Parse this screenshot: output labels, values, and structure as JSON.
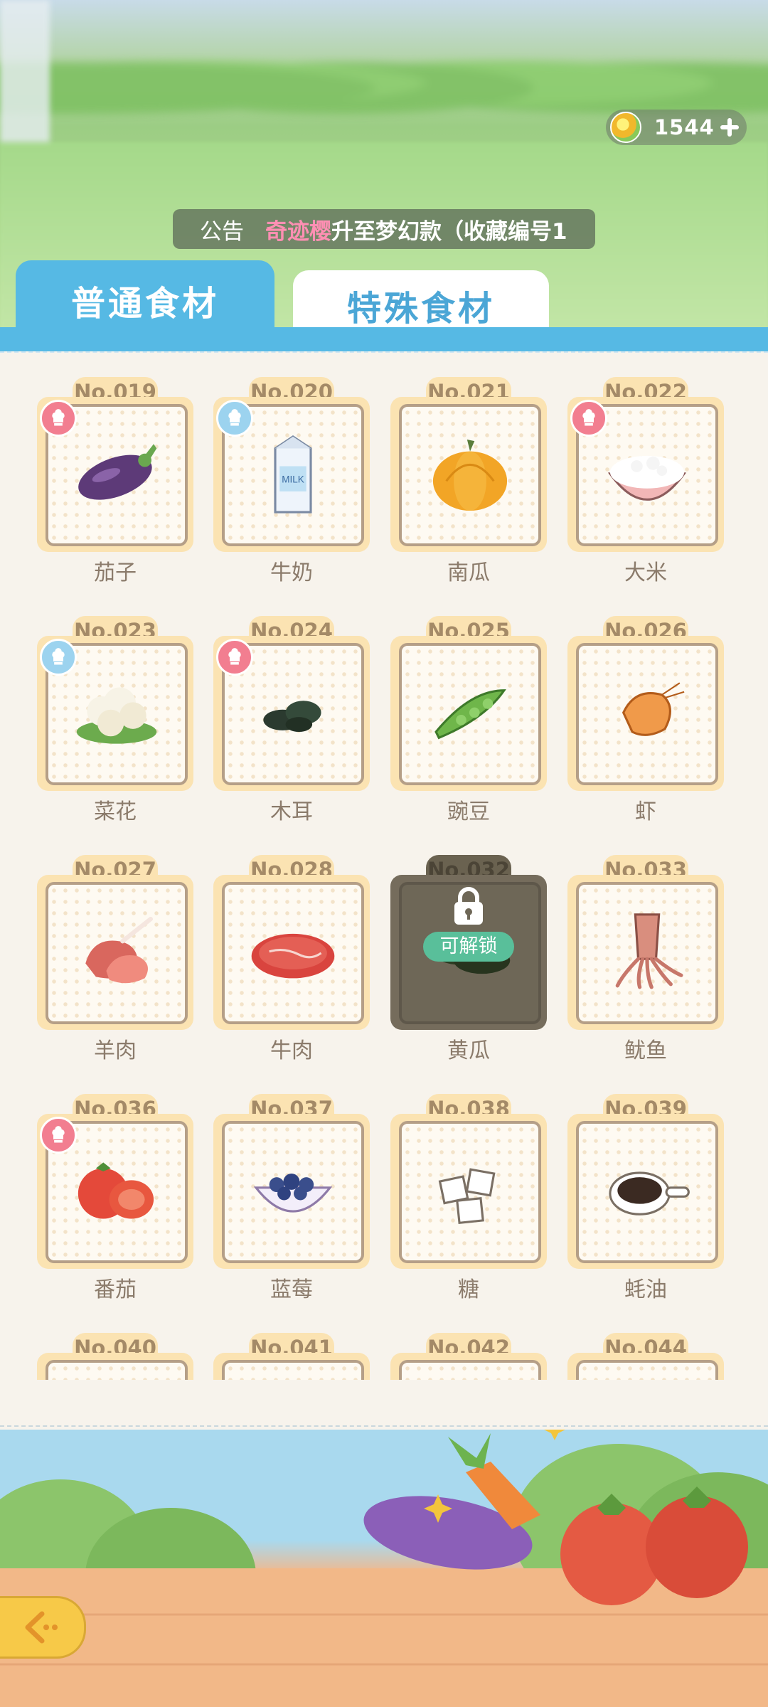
{
  "header": {
    "currency": {
      "value": "1544",
      "icon": "gem-coin-icon",
      "add_icon": "plus-icon"
    },
    "notice": {
      "label": "公告",
      "highlight": "奇迹樱",
      "text": "升至梦幻款（收藏编号1"
    }
  },
  "tabs": [
    {
      "label": "普通食材",
      "active": true
    },
    {
      "label": "特殊食材",
      "active": false
    }
  ],
  "colors": {
    "accent": "#56b9e4",
    "frame": "#fbe3b2",
    "label": "#8b7b6b",
    "unlock": "#59bf9a"
  },
  "items": [
    {
      "no": "No.019",
      "name": "茄子",
      "icon": "eggplant-icon",
      "badge": "pink"
    },
    {
      "no": "No.020",
      "name": "牛奶",
      "icon": "milk-carton-icon",
      "badge": "blue"
    },
    {
      "no": "No.021",
      "name": "南瓜",
      "icon": "pumpkin-icon",
      "badge": ""
    },
    {
      "no": "No.022",
      "name": "大米",
      "icon": "rice-bowl-icon",
      "badge": "pink"
    },
    {
      "no": "No.023",
      "name": "菜花",
      "icon": "cauliflower-icon",
      "badge": "blue"
    },
    {
      "no": "No.024",
      "name": "木耳",
      "icon": "wood-ear-icon",
      "badge": "pink"
    },
    {
      "no": "No.025",
      "name": "豌豆",
      "icon": "pea-pod-icon",
      "badge": ""
    },
    {
      "no": "No.026",
      "name": "虾",
      "icon": "shrimp-icon",
      "badge": ""
    },
    {
      "no": "No.027",
      "name": "羊肉",
      "icon": "lamb-chop-icon",
      "badge": ""
    },
    {
      "no": "No.028",
      "name": "牛肉",
      "icon": "beef-icon",
      "badge": ""
    },
    {
      "no": "No.032",
      "name": "黄瓜",
      "icon": "cucumber-icon",
      "badge": "",
      "locked": true,
      "unlock_label": "可解锁"
    },
    {
      "no": "No.033",
      "name": "鱿鱼",
      "icon": "squid-icon",
      "badge": ""
    },
    {
      "no": "No.036",
      "name": "番茄",
      "icon": "tomato-icon",
      "badge": "pink"
    },
    {
      "no": "No.037",
      "name": "蓝莓",
      "icon": "blueberry-bowl-icon",
      "badge": ""
    },
    {
      "no": "No.038",
      "name": "糖",
      "icon": "sugar-cube-icon",
      "badge": ""
    },
    {
      "no": "No.039",
      "name": "蚝油",
      "icon": "oyster-sauce-icon",
      "badge": ""
    },
    {
      "no": "No.040",
      "name": "",
      "icon": "",
      "badge": ""
    },
    {
      "no": "No.041",
      "name": "",
      "icon": "",
      "badge": ""
    },
    {
      "no": "No.042",
      "name": "",
      "icon": "",
      "badge": ""
    },
    {
      "no": "No.044",
      "name": "",
      "icon": "",
      "badge": ""
    }
  ],
  "footer": {
    "back_icon": "back-arrow-icon"
  }
}
